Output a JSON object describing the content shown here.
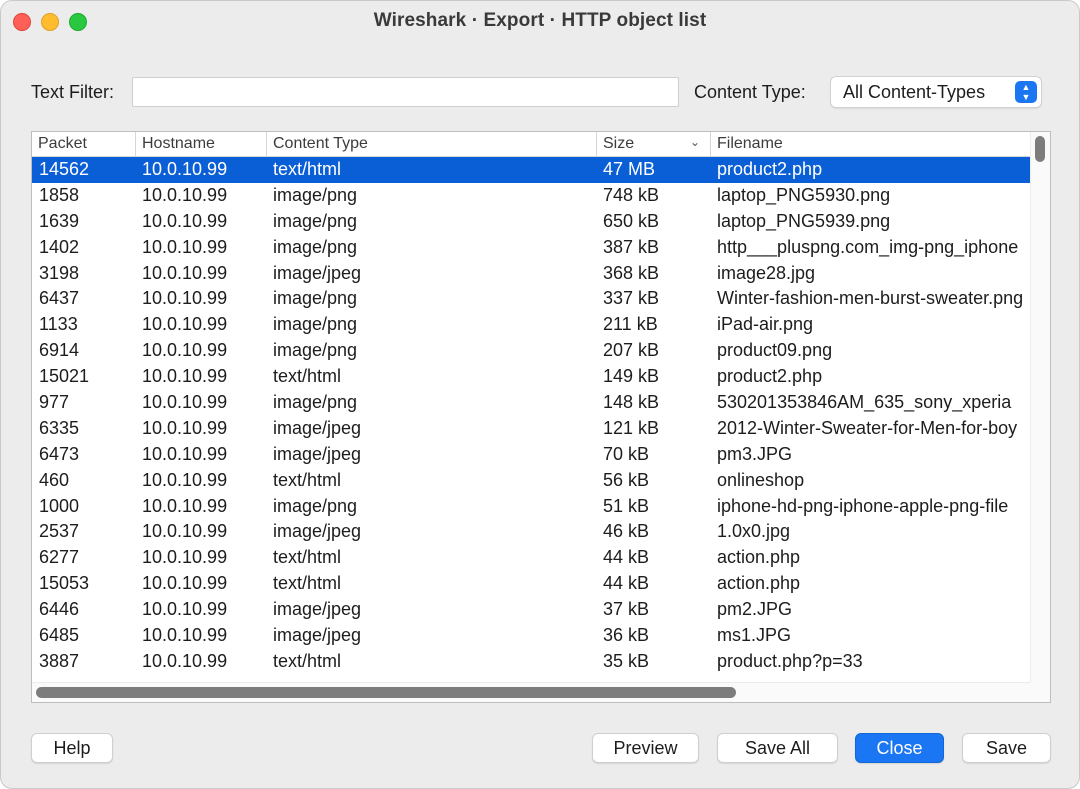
{
  "window": {
    "title": "Wireshark · Export · HTTP object list"
  },
  "filter": {
    "text_filter_label": "Text Filter:",
    "text_filter_value": "",
    "content_type_label": "Content Type:",
    "content_type_selected": "All Content-Types"
  },
  "table": {
    "columns": [
      "Packet",
      "Hostname",
      "Content Type",
      "Size",
      "Filename"
    ],
    "sorted_column": "Size",
    "sort_direction": "descending",
    "selected_row": 0,
    "rows": [
      {
        "packet": "14562",
        "host": "10.0.10.99",
        "ctype": "text/html",
        "size": "47 MB",
        "file": "product2.php"
      },
      {
        "packet": "1858",
        "host": "10.0.10.99",
        "ctype": "image/png",
        "size": "748 kB",
        "file": "laptop_PNG5930.png"
      },
      {
        "packet": "1639",
        "host": "10.0.10.99",
        "ctype": "image/png",
        "size": "650 kB",
        "file": "laptop_PNG5939.png"
      },
      {
        "packet": "1402",
        "host": "10.0.10.99",
        "ctype": "image/png",
        "size": "387 kB",
        "file": "http___pluspng.com_img-png_iphone"
      },
      {
        "packet": "3198",
        "host": "10.0.10.99",
        "ctype": "image/jpeg",
        "size": "368 kB",
        "file": "image28.jpg"
      },
      {
        "packet": "6437",
        "host": "10.0.10.99",
        "ctype": "image/png",
        "size": "337 kB",
        "file": "Winter-fashion-men-burst-sweater.png"
      },
      {
        "packet": "1133",
        "host": "10.0.10.99",
        "ctype": "image/png",
        "size": "211 kB",
        "file": "iPad-air.png"
      },
      {
        "packet": "6914",
        "host": "10.0.10.99",
        "ctype": "image/png",
        "size": "207 kB",
        "file": "product09.png"
      },
      {
        "packet": "15021",
        "host": "10.0.10.99",
        "ctype": "text/html",
        "size": "149 kB",
        "file": "product2.php"
      },
      {
        "packet": "977",
        "host": "10.0.10.99",
        "ctype": "image/png",
        "size": "148 kB",
        "file": "530201353846AM_635_sony_xperia"
      },
      {
        "packet": "6335",
        "host": "10.0.10.99",
        "ctype": "image/jpeg",
        "size": "121 kB",
        "file": "2012-Winter-Sweater-for-Men-for-boy"
      },
      {
        "packet": "6473",
        "host": "10.0.10.99",
        "ctype": "image/jpeg",
        "size": "70 kB",
        "file": "pm3.JPG"
      },
      {
        "packet": "460",
        "host": "10.0.10.99",
        "ctype": "text/html",
        "size": "56 kB",
        "file": "onlineshop"
      },
      {
        "packet": "1000",
        "host": "10.0.10.99",
        "ctype": "image/png",
        "size": "51 kB",
        "file": "iphone-hd-png-iphone-apple-png-file"
      },
      {
        "packet": "2537",
        "host": "10.0.10.99",
        "ctype": "image/jpeg",
        "size": "46 kB",
        "file": "1.0x0.jpg"
      },
      {
        "packet": "6277",
        "host": "10.0.10.99",
        "ctype": "text/html",
        "size": "44 kB",
        "file": "action.php"
      },
      {
        "packet": "15053",
        "host": "10.0.10.99",
        "ctype": "text/html",
        "size": "44 kB",
        "file": "action.php"
      },
      {
        "packet": "6446",
        "host": "10.0.10.99",
        "ctype": "image/jpeg",
        "size": "37 kB",
        "file": "pm2.JPG"
      },
      {
        "packet": "6485",
        "host": "10.0.10.99",
        "ctype": "image/jpeg",
        "size": "36 kB",
        "file": "ms1.JPG"
      },
      {
        "packet": "3887",
        "host": "10.0.10.99",
        "ctype": "text/html",
        "size": "35 kB",
        "file": "product.php?p=33"
      }
    ]
  },
  "buttons": {
    "help": "Help",
    "preview": "Preview",
    "save_all": "Save All",
    "close": "Close",
    "save": "Save"
  },
  "colors": {
    "selection": "#0a5fd6",
    "accent": "#1a76f2",
    "close_red": "#fe5f57",
    "minimize_yellow": "#febc2e",
    "maximize_green": "#28c840"
  },
  "icons": {
    "stepper": "chevron-up-down-icon",
    "sort": "chevron-down-icon"
  }
}
